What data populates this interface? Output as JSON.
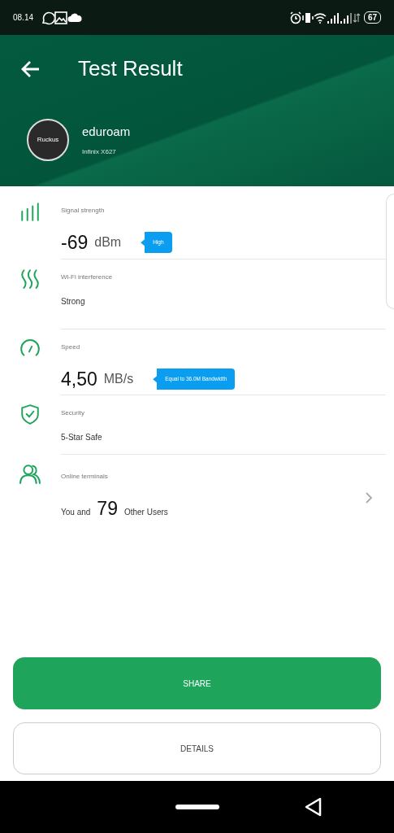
{
  "status_bar": {
    "time": "08.14",
    "battery": "67"
  },
  "header": {
    "title": "Test Result",
    "network": {
      "name": "eduroam",
      "device": "Infinix X627",
      "logo_text": "Ruckus"
    }
  },
  "rows": [
    {
      "kind": "metric",
      "label": "Signal strength",
      "value": "-69",
      "unit": "dBm",
      "bubble": "High"
    },
    {
      "kind": "text",
      "label": "Wi-Fi interference",
      "value": "Strong"
    },
    {
      "kind": "metric",
      "label": "Speed",
      "value": "4,50",
      "unit": "MB/s",
      "bubble": "Equal to 36.0M Bandwidth"
    },
    {
      "kind": "text",
      "label": "Security",
      "value": "5-Star Safe"
    },
    {
      "kind": "users",
      "label": "Online terminals",
      "prefix": "You and",
      "value": "79",
      "suffix": "Other Users"
    }
  ],
  "buttons": [
    {
      "label": "SHARE",
      "kind": "primary"
    },
    {
      "label": "DETAILS",
      "kind": "outline"
    }
  ]
}
